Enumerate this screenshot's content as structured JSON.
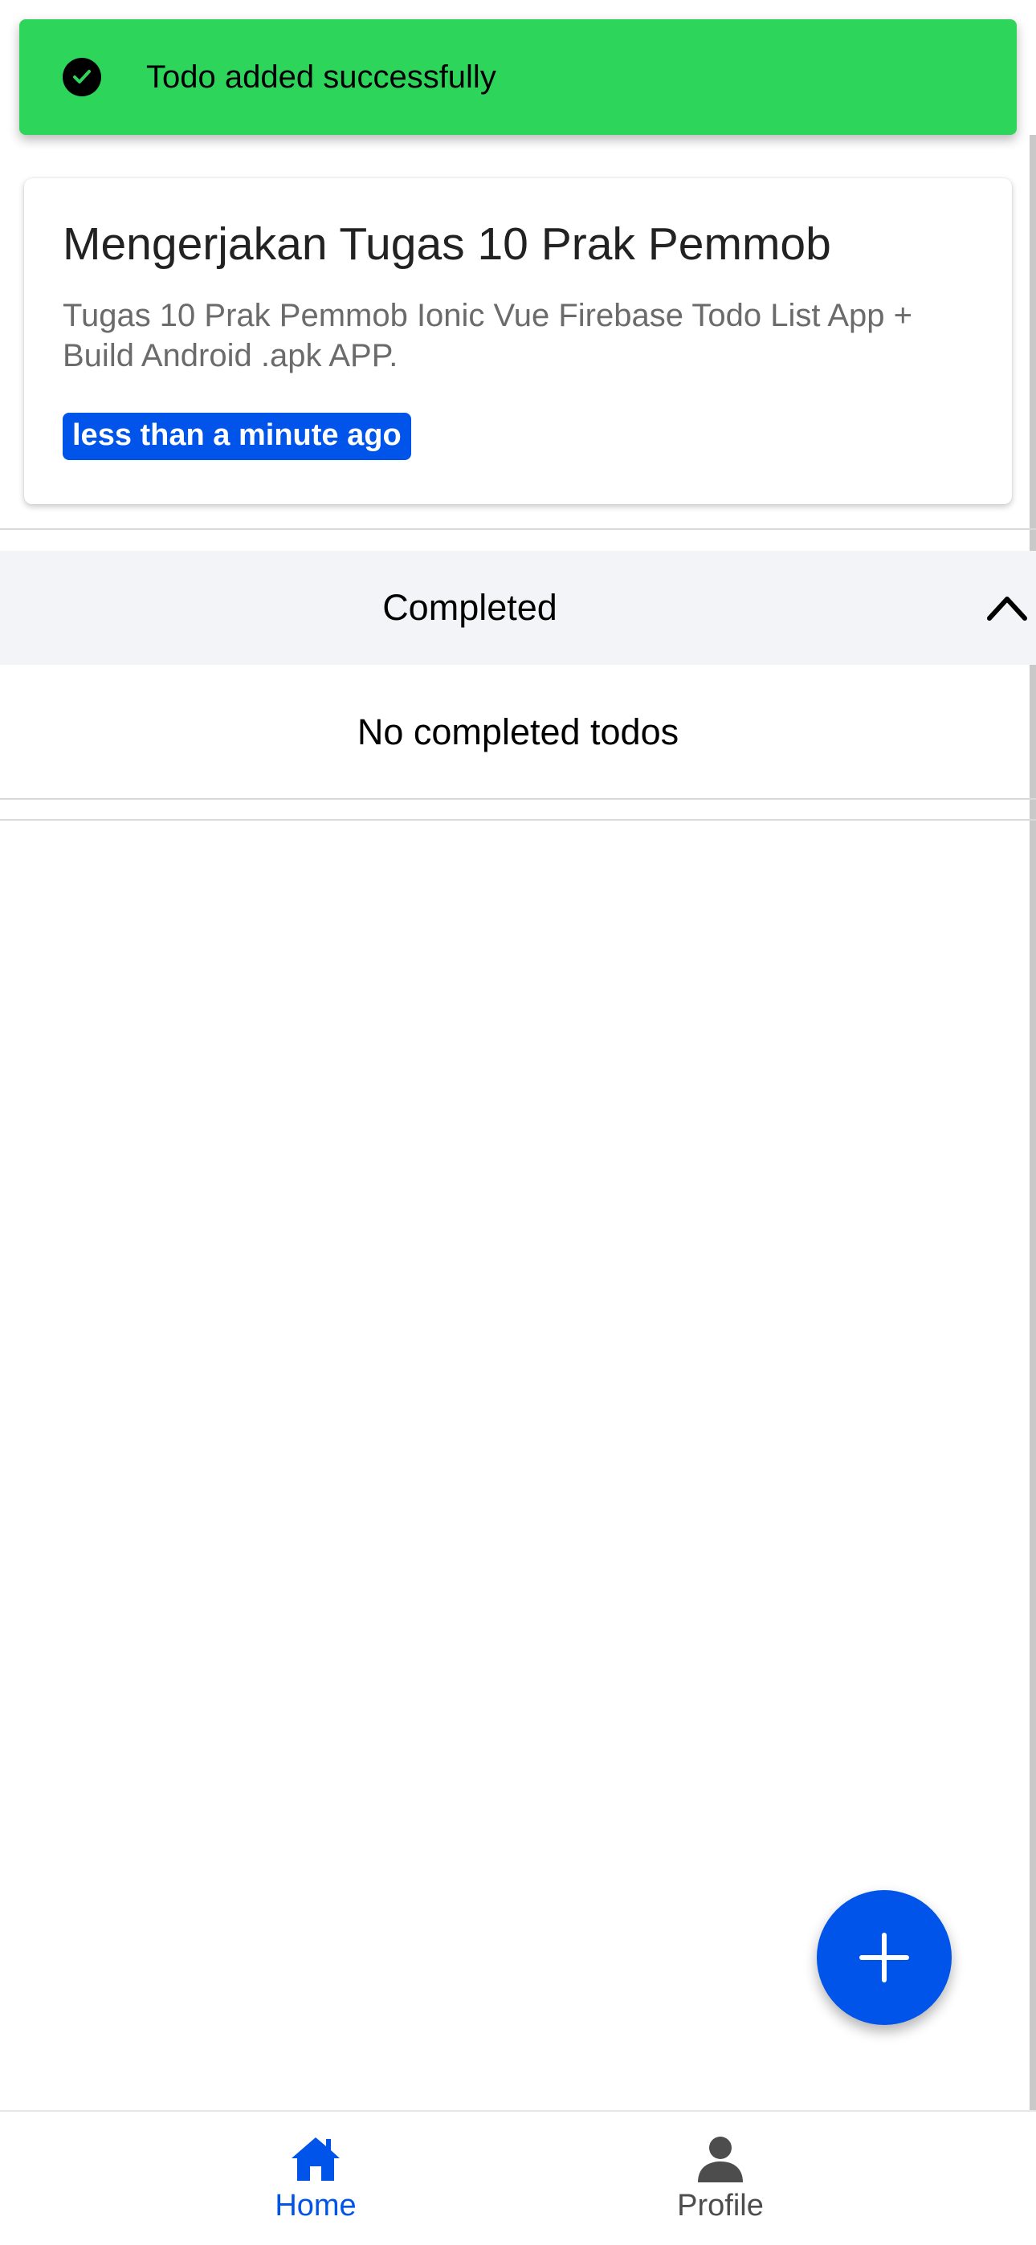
{
  "toast": {
    "message": "Todo added successfully",
    "icon": "checkmark-circle-icon",
    "color": "#2dd55b"
  },
  "todo": {
    "title": "Mengerjakan Tugas 10 Prak Pemmob",
    "description": "Tugas 10 Prak Pemmob Ionic Vue Firebase Todo List App + Build Android .apk APP.",
    "time": "less than a minute ago"
  },
  "completed_section": {
    "label": "Completed",
    "expanded": true,
    "icon": "chevron-up-icon",
    "empty_message": "No completed todos"
  },
  "fab": {
    "icon": "add-icon"
  },
  "tabs": [
    {
      "label": "Home",
      "icon": "home-icon",
      "selected": true
    },
    {
      "label": "Profile",
      "icon": "person-icon",
      "selected": false
    }
  ],
  "colors": {
    "primary": "#0054e9",
    "toast_success": "#2dd55b",
    "accordion_bg": "#f3f4f7"
  }
}
